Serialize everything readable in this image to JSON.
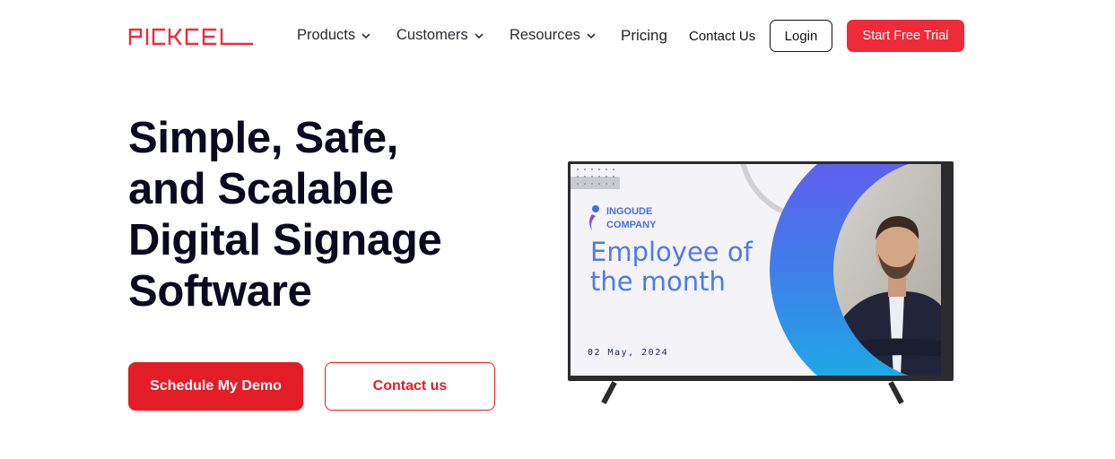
{
  "brand": {
    "name": "PICKCEL",
    "accent": "#ef2b3a"
  },
  "nav": {
    "items": [
      {
        "label": "Products",
        "icon": "chevron-down-icon"
      },
      {
        "label": "Customers",
        "icon": "chevron-down-icon"
      },
      {
        "label": "Resources",
        "icon": "chevron-down-icon"
      },
      {
        "label": "Pricing"
      },
      {
        "label": "Contact Us"
      }
    ],
    "login_label": "Login",
    "trial_label": "Start Free Trial"
  },
  "hero": {
    "title_lines": [
      "Simple, Safe,",
      "and Scalable",
      "Digital Signage",
      "Software"
    ],
    "primary_cta": "Schedule My Demo",
    "secondary_cta": "Contact us"
  },
  "tv_display": {
    "company_line1": "INGOUDE",
    "company_line2": "COMPANY",
    "headline": "Employee of the month",
    "date": "02 May, 2024"
  }
}
